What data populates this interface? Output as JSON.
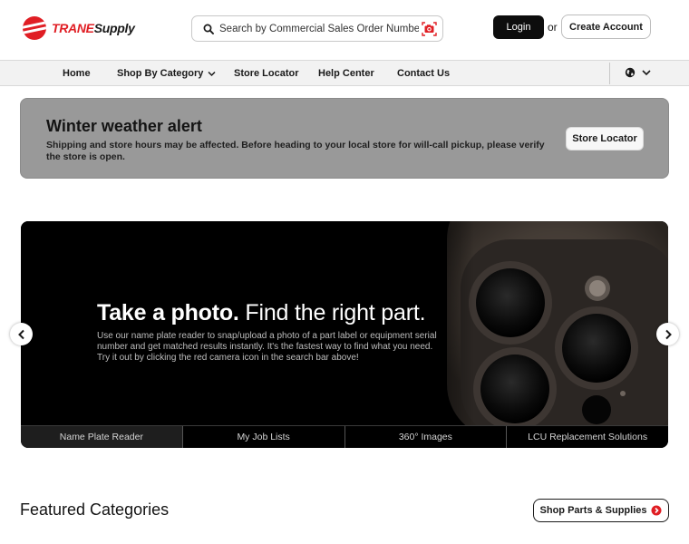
{
  "brand": {
    "name_part1": "TRANE",
    "name_part2": "Supply",
    "accent": "#e01e24"
  },
  "search": {
    "placeholder": "Search by Commercial Sales Order Number"
  },
  "auth": {
    "login_label": "Login",
    "or_label": "or",
    "create_label": "Create Account"
  },
  "nav": {
    "items": [
      {
        "label": "Home"
      },
      {
        "label": "Shop By Category"
      },
      {
        "label": "Store Locator"
      },
      {
        "label": "Help Center"
      },
      {
        "label": "Contact Us"
      }
    ]
  },
  "alert": {
    "title": "Winter weather alert",
    "body": "Shipping and store hours may be affected. Before heading to your local store for will-call pickup, please verify the store is open.",
    "button_label": "Store Locator"
  },
  "hero": {
    "title_bold": "Take a photo.",
    "title_rest": " Find the right part.",
    "body": "Use our name plate reader to snap/upload a photo of a part label or equipment serial number and get matched results instantly. It's the fastest way to find what you need. Try it out by clicking the red camera icon in the search bar above!",
    "tabs": [
      {
        "label": "Name Plate Reader"
      },
      {
        "label": "My Job Lists"
      },
      {
        "label": "360° Images"
      },
      {
        "label": "LCU Replacement Solutions"
      }
    ]
  },
  "featured": {
    "title": "Featured Categories",
    "button_label": "Shop Parts & Supplies"
  }
}
